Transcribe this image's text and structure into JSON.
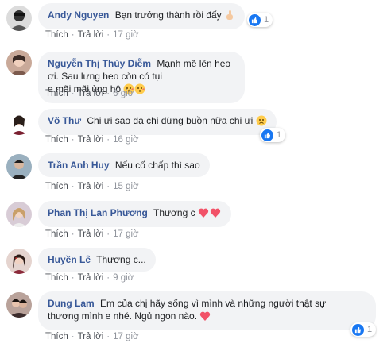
{
  "actions": {
    "like": "Thích",
    "reply": "Trả lời",
    "separator": "·"
  },
  "colors": {
    "name": "#385898",
    "bubble": "#f2f3f5",
    "like_blue": "#1877f2",
    "heart": "#f25268"
  },
  "comments": [
    {
      "name": "Andy Nguyen",
      "text": "Bạn trưởng thành rồi đấy",
      "emoji": "pointing-finger",
      "time": "17 giờ",
      "reactions": "1"
    },
    {
      "name": "Nguyễn Thị Thúy Diễm",
      "text": "Mạnh mẽ lên heo ơi. Sau lưng heo còn có tụi",
      "text2": "e mãi mãi ủng hộ",
      "emoji": "kiss-face",
      "time": "6 giờ"
    },
    {
      "name": "Võ Thư",
      "text": "Chị ưi sao dạ chị đừng buồn nữa chị ưi",
      "emoji": "sad-face",
      "time": "16 giờ",
      "reactions": "1"
    },
    {
      "name": "Trần Anh Huy",
      "text": "Nếu cố chấp thì sao",
      "time": "15 giờ"
    },
    {
      "name": "Phan Thị Lan Phương",
      "text": "Thương c",
      "emoji": "hearts",
      "time": "17 giờ"
    },
    {
      "name": "Huyền Lê",
      "text": "Thương c...",
      "time": "9 giờ"
    },
    {
      "name": "Dung Lam",
      "text": "Em của chị hãy sống vì mình và những người thật sự",
      "text2": "thương mình e nhé. Ngủ ngon nào.",
      "emoji": "heart",
      "time": "17 giờ",
      "reactions": "1"
    }
  ]
}
